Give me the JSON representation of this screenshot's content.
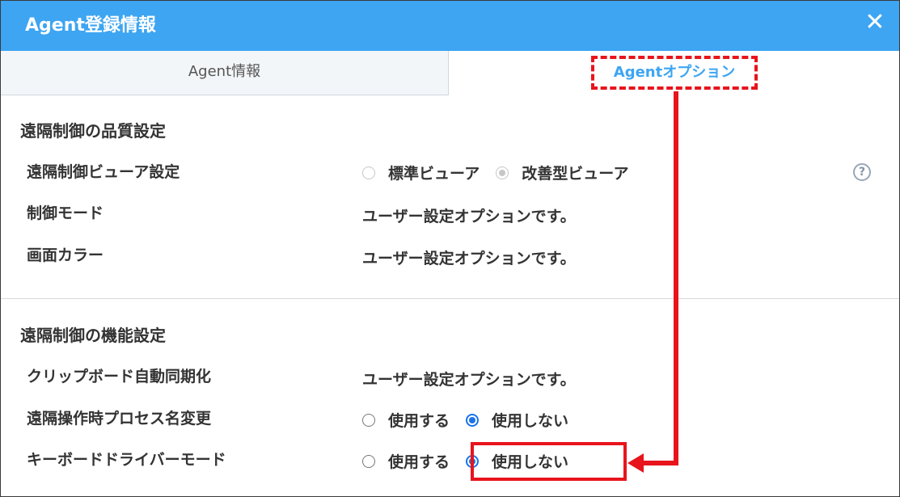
{
  "dialog": {
    "title": "Agent登録情報",
    "close": "✕"
  },
  "tabs": [
    {
      "label": "Agent情報",
      "active": false
    },
    {
      "label": "Agentオプション",
      "active": true
    }
  ],
  "sections": {
    "quality": {
      "title": "遠隔制御の品質設定",
      "viewer_label": "遠隔制御ビューア設定",
      "viewer_option1": "標準ビューア",
      "viewer_option2": "改善型ビューア",
      "viewer_selected": "改善型ビューア",
      "mode_label": "制御モード",
      "mode_value": "ユーザー設定オプションです。",
      "color_label": "画面カラー",
      "color_value": "ユーザー設定オプションです。",
      "help": "?"
    },
    "function": {
      "title": "遠隔制御の機能設定",
      "clip_label": "クリップボード自動同期化",
      "clip_value": "ユーザー設定オプションです。",
      "proc_label": "遠隔操作時プロセス名変更",
      "proc_opt_use": "使用する",
      "proc_opt_nouse": "使用しない",
      "proc_selected": "使用しない",
      "kb_label": "キーボードドライバーモード",
      "kb_opt_use": "使用する",
      "kb_opt_nouse": "使用しない",
      "kb_selected": "使用しない"
    }
  },
  "colors": {
    "header": "#3da5f2",
    "accent": "#1a73e8",
    "annotation": "#e8141c"
  }
}
